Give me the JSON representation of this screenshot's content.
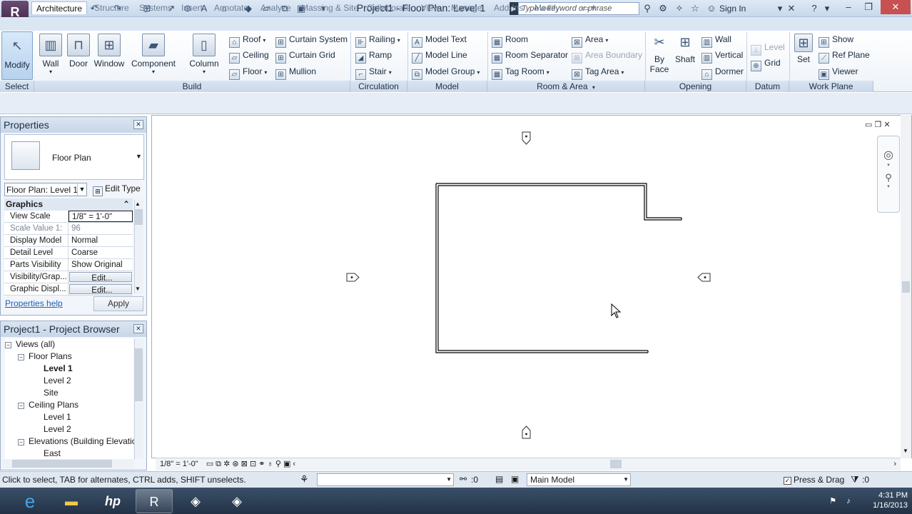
{
  "titlebar": {
    "app_menu_label": "R",
    "document_title": "Project1 - Floor Plan: Level 1",
    "search_placeholder": "Type a keyword or phrase",
    "sign_in": "Sign In"
  },
  "ribbon_tabs": [
    "Architecture",
    "Structure",
    "Systems",
    "Insert",
    "Annotate",
    "Analyze",
    "Massing & Site",
    "Collaborate",
    "View",
    "Manage",
    "Add-Ins",
    "Modify"
  ],
  "ribbon": {
    "select": {
      "modify": "Modify",
      "panel": "Select"
    },
    "build": {
      "panel": "Build",
      "wall": "Wall",
      "door": "Door",
      "window": "Window",
      "component": "Component",
      "column": "Column",
      "roof": "Roof",
      "ceiling": "Ceiling",
      "floor": "Floor",
      "curtain_system": "Curtain System",
      "curtain_grid": "Curtain Grid",
      "mullion": "Mullion"
    },
    "circulation": {
      "panel": "Circulation",
      "railing": "Railing",
      "ramp": "Ramp",
      "stair": "Stair"
    },
    "model": {
      "panel": "Model",
      "model_text": "Model Text",
      "model_line": "Model Line",
      "model_group": "Model Group"
    },
    "room_area": {
      "panel": "Room & Area",
      "room": "Room",
      "room_separator": "Room Separator",
      "tag_room": "Tag Room",
      "area": "Area",
      "area_boundary": "Area Boundary",
      "tag_area": "Tag Area"
    },
    "opening": {
      "panel": "Opening",
      "by_face_1": "By",
      "by_face_2": "Face",
      "shaft": "Shaft",
      "wall": "Wall",
      "vertical": "Vertical",
      "dormer": "Dormer"
    },
    "datum": {
      "panel": "Datum",
      "level": "Level",
      "grid": "Grid"
    },
    "work_plane": {
      "panel": "Work Plane",
      "set": "Set",
      "show": "Show",
      "ref_plane": "Ref Plane",
      "viewer": "Viewer"
    }
  },
  "properties": {
    "title": "Properties",
    "type_name": "Floor Plan",
    "instance": "Floor Plan: Level 1",
    "edit_type": "Edit Type",
    "group": "Graphics",
    "rows": [
      {
        "key": "View Scale",
        "value": "1/8\" = 1'-0\""
      },
      {
        "key": "Scale Value   1:",
        "value": "96"
      },
      {
        "key": "Display Model",
        "value": "Normal"
      },
      {
        "key": "Detail Level",
        "value": "Coarse"
      },
      {
        "key": "Parts Visibility",
        "value": "Show Original"
      },
      {
        "key": "Visibility/Grap...",
        "value": "Edit..."
      },
      {
        "key": "Graphic Displ...",
        "value": "Edit..."
      }
    ],
    "help": "Properties help",
    "apply": "Apply"
  },
  "browser": {
    "title": "Project1 - Project Browser",
    "items": [
      {
        "label": "Views (all)",
        "level": 0,
        "toggle": "−",
        "bold": false
      },
      {
        "label": "Floor Plans",
        "level": 1,
        "toggle": "−",
        "bold": false
      },
      {
        "label": "Level 1",
        "level": 2,
        "toggle": "",
        "bold": true
      },
      {
        "label": "Level 2",
        "level": 2,
        "toggle": "",
        "bold": false
      },
      {
        "label": "Site",
        "level": 2,
        "toggle": "",
        "bold": false
      },
      {
        "label": "Ceiling Plans",
        "level": 1,
        "toggle": "−",
        "bold": false
      },
      {
        "label": "Level 1",
        "level": 2,
        "toggle": "",
        "bold": false
      },
      {
        "label": "Level 2",
        "level": 2,
        "toggle": "",
        "bold": false
      },
      {
        "label": "Elevations (Building Elevatio",
        "level": 1,
        "toggle": "−",
        "bold": false
      },
      {
        "label": "East",
        "level": 2,
        "toggle": "",
        "bold": false
      }
    ]
  },
  "viewbar": {
    "scale": "1/8\" = 1'-0\""
  },
  "statusbar": {
    "text": "Click to select, TAB for alternates, CTRL adds, SHIFT unselects.",
    "editing_count": ":0",
    "model": "Main Model",
    "press_drag": "Press & Drag",
    "filter_count": ":0"
  },
  "taskbar": {
    "time": "4:31 PM",
    "date": "1/16/2013",
    "hp_label": "hp"
  }
}
